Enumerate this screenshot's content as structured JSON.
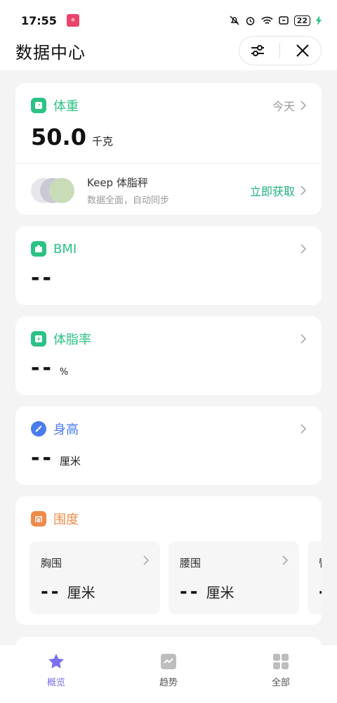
{
  "status": {
    "time": "17:55",
    "battery": "22"
  },
  "header": {
    "title": "数据中心"
  },
  "weight": {
    "label": "体重",
    "date": "今天",
    "value": "50.0",
    "unit": "千克"
  },
  "promo": {
    "title": "Keep 体脂秤",
    "subtitle": "数据全面，自动同步",
    "cta": "立即获取"
  },
  "bmi": {
    "label": "BMI",
    "value": "--"
  },
  "bodyfat": {
    "label": "体脂率",
    "value": "--",
    "unit": "%"
  },
  "height": {
    "label": "身高",
    "value": "--",
    "unit": "厘米"
  },
  "girth": {
    "label": "围度",
    "items": [
      {
        "label": "胸围",
        "value": "--",
        "unit": "厘米"
      },
      {
        "label": "腰围",
        "value": "--",
        "unit": "厘米"
      },
      {
        "label": "臀",
        "value": "-"
      }
    ]
  },
  "tabs": [
    {
      "label": "概览",
      "icon": "star-icon"
    },
    {
      "label": "趋势",
      "icon": "trend-icon"
    },
    {
      "label": "全部",
      "icon": "grid-icon"
    }
  ],
  "colors": {
    "green": "#2cc285",
    "blue": "#4a7cf0",
    "orange": "#f08a4b",
    "purple": "#7a6ff0"
  }
}
